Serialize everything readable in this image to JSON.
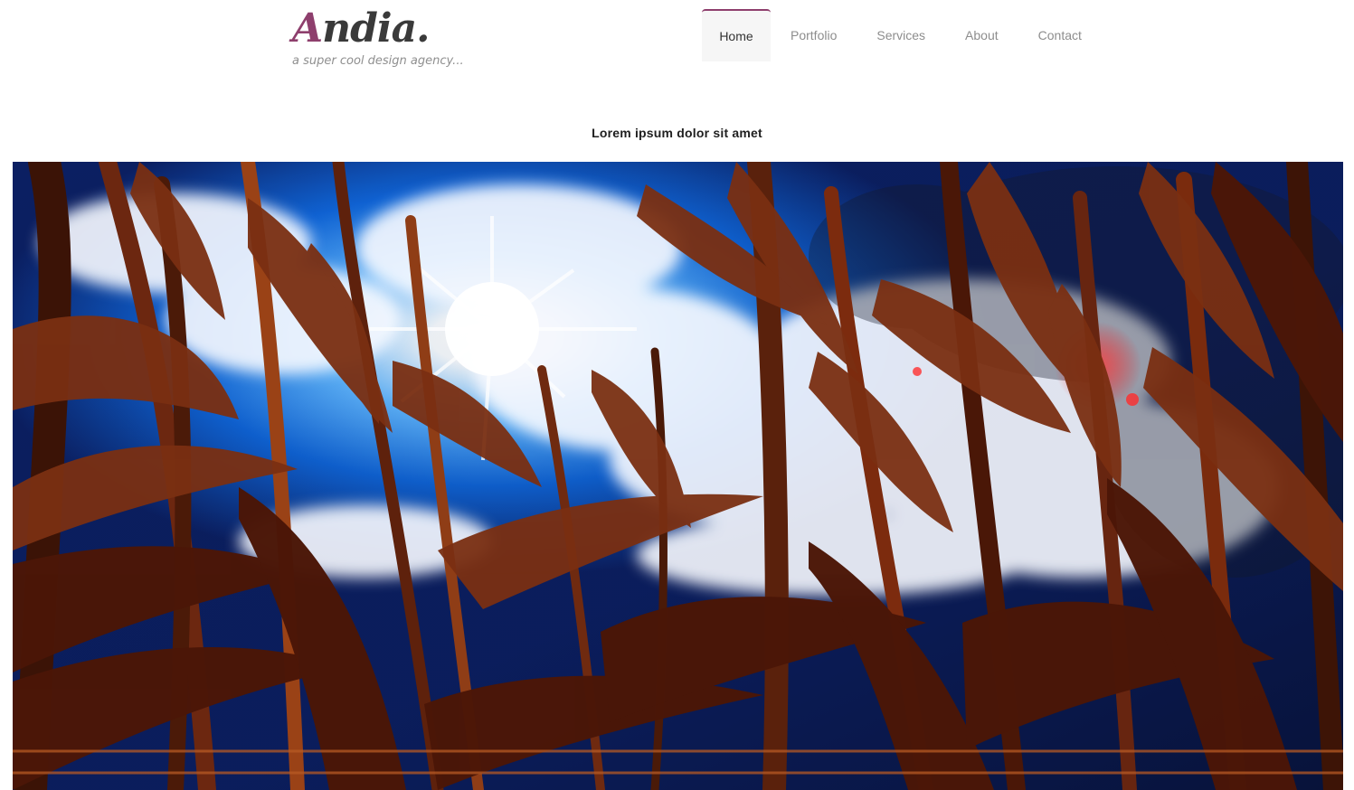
{
  "brand": {
    "initial": "A",
    "rest": "ndia.",
    "tagline": "a super cool design agency..."
  },
  "nav": {
    "items": [
      {
        "label": "Home",
        "active": true
      },
      {
        "label": "Portfolio",
        "active": false
      },
      {
        "label": "Services",
        "active": false
      },
      {
        "label": "About",
        "active": false
      },
      {
        "label": "Contact",
        "active": false
      }
    ]
  },
  "content": {
    "heading": "Lorem ipsum dolor sit amet"
  },
  "colors": {
    "accent": "#8e3f6d",
    "nav_active_bg": "#f6f6f6",
    "nav_text": "#8d8d8d",
    "heading_text": "#202020",
    "sky_blue": "#1f6fe0",
    "corn_brown": "#7a2f12"
  },
  "hero": {
    "image_subject": "cornfield-against-blue-sky-with-sun"
  }
}
